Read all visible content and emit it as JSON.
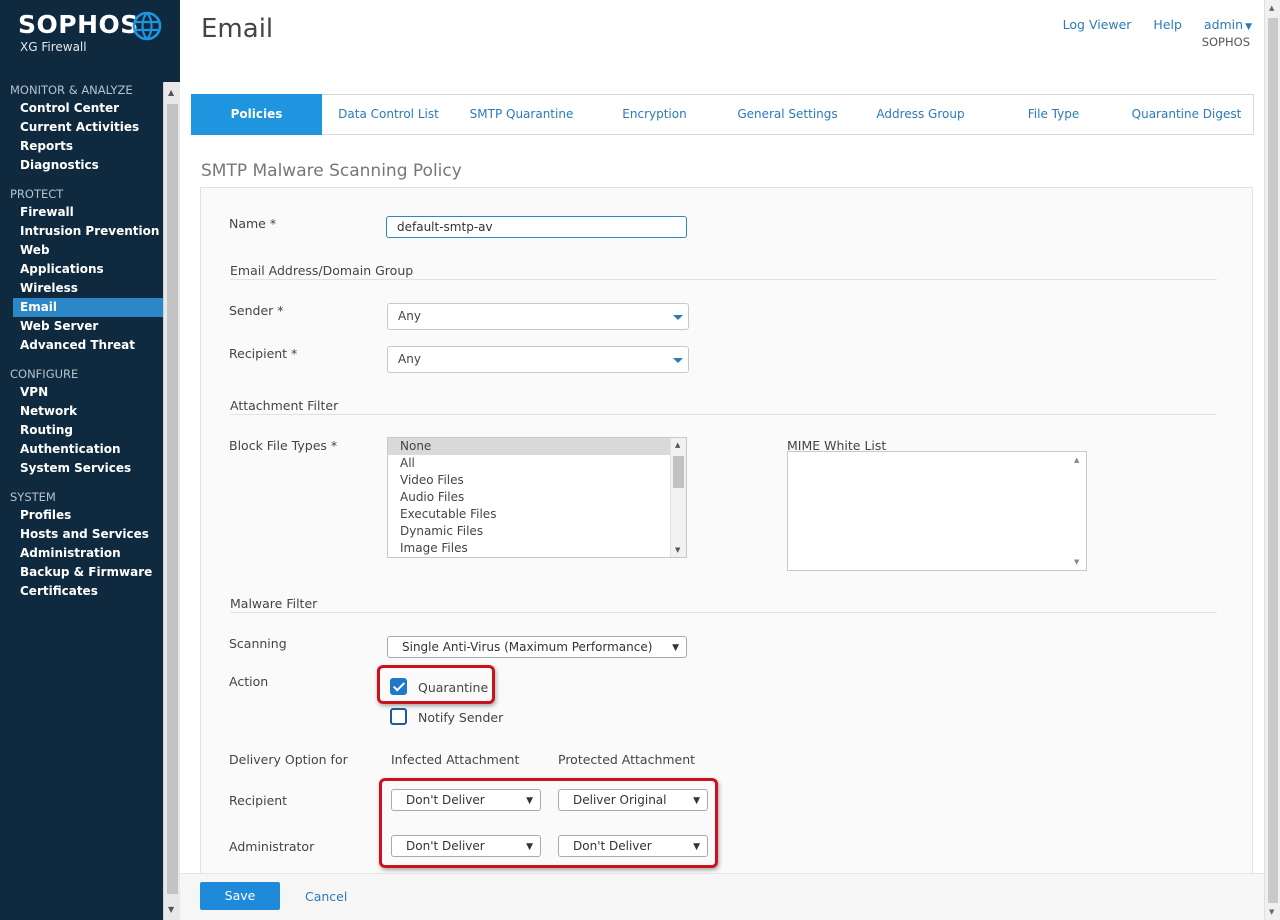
{
  "brand": {
    "name": "SOPHOS",
    "product": "XG Firewall",
    "accent": "#1f95e0",
    "sidebar_bg": "#0f2a3e"
  },
  "header": {
    "title": "Email",
    "links": {
      "log_viewer": "Log Viewer",
      "help": "Help",
      "user": "admin"
    },
    "org": "SOPHOS"
  },
  "sidebar": {
    "sections": [
      {
        "heading": "MONITOR & ANALYZE",
        "items": [
          "Control Center",
          "Current Activities",
          "Reports",
          "Diagnostics"
        ]
      },
      {
        "heading": "PROTECT",
        "items": [
          "Firewall",
          "Intrusion Prevention",
          "Web",
          "Applications",
          "Wireless",
          "Email",
          "Web Server",
          "Advanced Threat"
        ]
      },
      {
        "heading": "CONFIGURE",
        "items": [
          "VPN",
          "Network",
          "Routing",
          "Authentication",
          "System Services"
        ]
      },
      {
        "heading": "SYSTEM",
        "items": [
          "Profiles",
          "Hosts and Services",
          "Administration",
          "Backup & Firmware",
          "Certificates"
        ]
      }
    ],
    "active": "Email"
  },
  "tabs": [
    "Policies",
    "Data Control List",
    "SMTP Quarantine",
    "Encryption",
    "General Settings",
    "Address Group",
    "File Type",
    "Quarantine Digest"
  ],
  "active_tab": "Policies",
  "form": {
    "section_title": "SMTP Malware Scanning Policy",
    "name_label": "Name *",
    "name_value": "default-smtp-av",
    "group_email": "Email Address/Domain Group",
    "sender_label": "Sender *",
    "sender_value": "Any",
    "recipient_label": "Recipient *",
    "recipient_value": "Any",
    "group_attachment": "Attachment Filter",
    "block_label": "Block File Types *",
    "block_options": [
      "None",
      "All",
      "Video Files",
      "Audio Files",
      "Executable Files",
      "Dynamic Files",
      "Image Files"
    ],
    "block_selected": "None",
    "mime_label": "MIME White List",
    "group_malware": "Malware Filter",
    "scanning_label": "Scanning",
    "scanning_value": "Single Anti-Virus (Maximum Performance)",
    "action_label": "Action",
    "quarantine_label": "Quarantine",
    "quarantine_checked": true,
    "notify_label": "Notify Sender",
    "notify_checked": false,
    "delivery_label": "Delivery Option for",
    "infected_head": "Infected Attachment",
    "protected_head": "Protected Attachment",
    "row_recipient": "Recipient",
    "row_admin": "Administrator",
    "recipient_infected": "Don't Deliver",
    "recipient_protected": "Deliver Original",
    "admin_infected": "Don't Deliver",
    "admin_protected": "Don't Deliver"
  },
  "footer": {
    "save": "Save",
    "cancel": "Cancel"
  }
}
